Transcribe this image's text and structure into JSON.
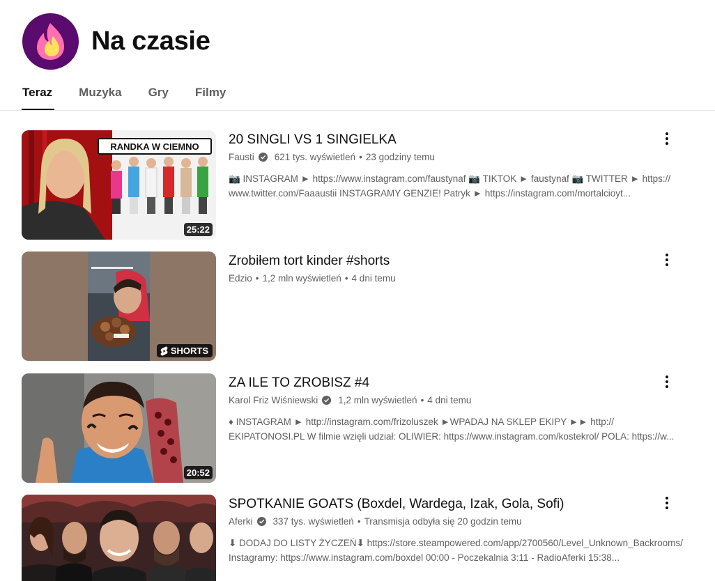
{
  "header": {
    "title": "Na czasie",
    "logo_icon": "flame-icon"
  },
  "tabs": [
    {
      "label": "Teraz",
      "active": true
    },
    {
      "label": "Muzyka",
      "active": false
    },
    {
      "label": "Gry",
      "active": false
    },
    {
      "label": "Filmy",
      "active": false
    }
  ],
  "videos": [
    {
      "title": "20 SINGLI VS 1 SINGIELKA",
      "channel": "Fausti",
      "verified": true,
      "views": "621 tys. wyświetleń",
      "age": "23 godziny temu",
      "badge": "25:22",
      "thumb_text": "RANDKA W CIEMNO",
      "desc_line1": "📷 INSTAGRAM ► https://www.instagram.com/faustynaf 📷 TIKTOK ► faustynaf 📷 TWITTER ► https://",
      "desc_line2": "www.twitter.com/Faaaustii INSTAGRAMY GENZIE! Patryk ► https://instagram.com/mortalcioyt..."
    },
    {
      "title": "Zrobiłem tort kinder #shorts",
      "channel": "Edzio",
      "verified": false,
      "views": "1,2 mln wyświetleń",
      "age": "4 dni temu",
      "badge": "SHORTS",
      "desc_line1": "",
      "desc_line2": ""
    },
    {
      "title": "ZA ILE TO ZROBISZ #4",
      "channel": "Karol Friz Wiśniewski",
      "verified": true,
      "views": "1,2 mln wyświetleń",
      "age": "4 dni temu",
      "badge": "20:52",
      "desc_line1": "♦ INSTAGRAM ► http://instagram.com/frizoluszek ►WPADAJ NA SKLEP EKIPY ►► http://",
      "desc_line2": "EKIPATONOSI.PL W filmie wzięli udział: OLIWIER: https://www.instagram.com/kostekrol/ POLA: https://w..."
    },
    {
      "title": "SPOTKANIE GOATS (Boxdel, Wardega, Izak, Gola, Sofi)",
      "channel": "Aferki",
      "verified": true,
      "views": "337 tys. wyświetleń",
      "age": "Transmisja odbyła się 20 godzin temu",
      "badge": "",
      "desc_line1": "⬇ DODAJ DO LISTY ŻYCZEŃ⬇ https://store.steampowered.com/app/2700560/Level_Unknown_Backrooms/",
      "desc_line2": "Instagramy: https://www.instagram.com/boxdel 00:00 - Poczekalnia 3:11 - RadioAferki 15:38..."
    }
  ],
  "colors": {
    "text": "#0f0f0f",
    "secondary": "#606060",
    "divider": "#e5e5e5",
    "logo_bg": "#5a0b6e"
  }
}
